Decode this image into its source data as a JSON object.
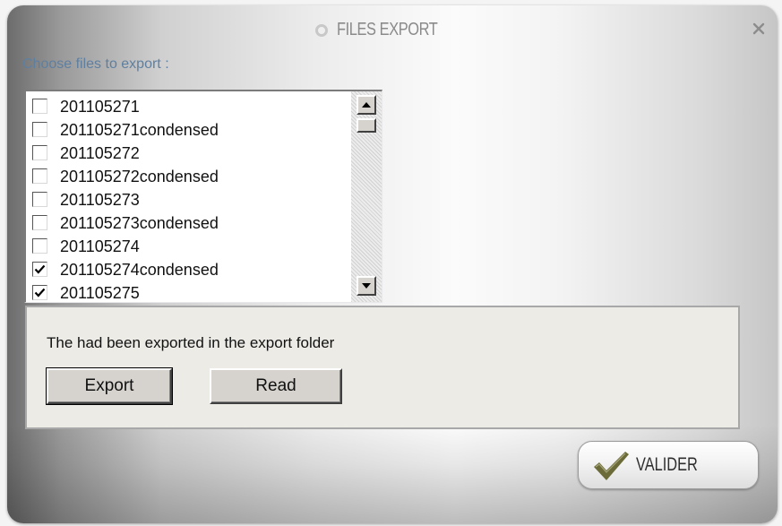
{
  "window": {
    "title": "FILES EXPORT"
  },
  "choose_label": "Choose files to export :",
  "file_list": [
    {
      "label": "201105271",
      "checked": false
    },
    {
      "label": "201105271condensed",
      "checked": false
    },
    {
      "label": "201105272",
      "checked": false
    },
    {
      "label": "201105272condensed",
      "checked": false
    },
    {
      "label": "201105273",
      "checked": false
    },
    {
      "label": "201105273condensed",
      "checked": false
    },
    {
      "label": "201105274",
      "checked": false
    },
    {
      "label": "201105274condensed",
      "checked": true
    },
    {
      "label": "201105275",
      "checked": true
    }
  ],
  "panel": {
    "status_text": "The had been exported in the export folder",
    "export_label": "Export",
    "read_label": "Read"
  },
  "valider_label": "VALIDER",
  "icons": {
    "close": "close-icon",
    "title_bullet": "circle-icon",
    "valider": "checkmark-icon",
    "checkbox_checked": "checkmark-icon",
    "scroll_up": "arrow-up-icon",
    "scroll_down": "arrow-down-icon"
  },
  "colors": {
    "choose_label": "#5f7fa0",
    "title": "#8a8a8a",
    "panel_bg": "#ecebe6",
    "button_face": "#d6d3ce",
    "valider_check": "#6b6b3a"
  }
}
